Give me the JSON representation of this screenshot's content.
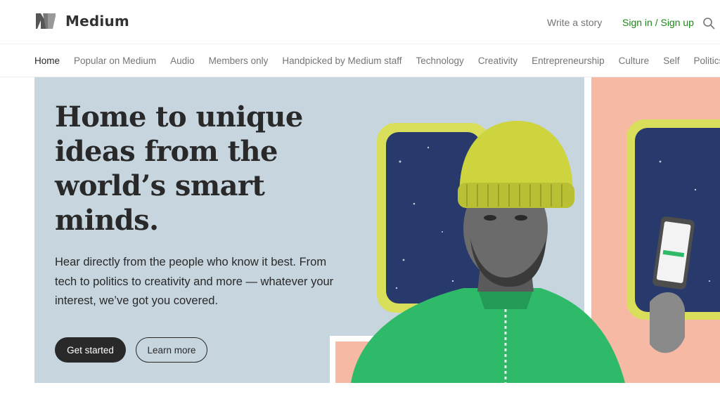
{
  "header": {
    "brand": "Medium",
    "write_label": "Write a story",
    "signin_label": "Sign in / Sign up"
  },
  "topics": [
    "Home",
    "Popular on Medium",
    "Audio",
    "Members only",
    "Handpicked by Medium staff",
    "Technology",
    "Creativity",
    "Entrepreneurship",
    "Culture",
    "Self",
    "Politics"
  ],
  "hero": {
    "title": "Home to unique ideas from the world’s smart minds.",
    "subtitle": "Hear directly from the people who know it best. From tech to politics to creativity and more — whatever your interest, we’ve got you covered.",
    "primary_cta": "Get started",
    "secondary_cta": "Learn more"
  },
  "colors": {
    "accent_green": "#1a8917",
    "hero_blue": "#c6d5de",
    "hero_peach": "#f6b9a4",
    "dark": "#292929"
  },
  "icons": {
    "logo": "medium-logo-icon",
    "search": "search-icon"
  }
}
